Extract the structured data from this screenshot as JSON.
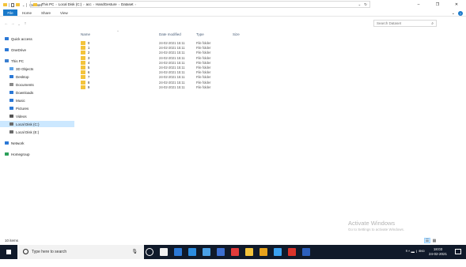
{
  "window": {
    "title": "Dataset",
    "minimize_glyph": "–",
    "maximize_glyph": "❐",
    "close_glyph": "✕"
  },
  "ribbon": {
    "tabs": [
      "File",
      "Home",
      "Share",
      "View"
    ],
    "expand_glyph": "⌄",
    "help_glyph": "?"
  },
  "nav": {
    "back": "←",
    "forward": "→",
    "recent": "⌄",
    "up": "↑"
  },
  "address": {
    "breadcrumbs": [
      "This PC",
      "Local Disk (C:)",
      "acc",
      "HandGesture",
      "Dataset"
    ],
    "dropdown_glyph": "⌄",
    "refresh_glyph": "↻"
  },
  "search": {
    "placeholder": "Search Dataset",
    "icon_glyph": "⌕"
  },
  "sidebar": {
    "items": [
      {
        "label": "Quick access",
        "icon": "star-icon",
        "color": "#2b78d6"
      },
      {
        "label": "OneDrive",
        "icon": "cloud-icon",
        "color": "#2b78d6"
      },
      {
        "label": "This PC",
        "icon": "computer-icon",
        "color": "#3a7fd0"
      },
      {
        "label": "3D Objects",
        "icon": "cube-icon",
        "color": "#5aa2e8"
      },
      {
        "label": "Desktop",
        "icon": "desktop-icon",
        "color": "#2b78d6"
      },
      {
        "label": "Documents",
        "icon": "document-icon",
        "color": "#8a8a8a"
      },
      {
        "label": "Downloads",
        "icon": "download-icon",
        "color": "#2b78d6"
      },
      {
        "label": "Music",
        "icon": "music-icon",
        "color": "#2b78d6"
      },
      {
        "label": "Pictures",
        "icon": "pictures-icon",
        "color": "#2b78d6"
      },
      {
        "label": "Videos",
        "icon": "video-icon",
        "color": "#555555"
      },
      {
        "label": "Local Disk (C:)",
        "icon": "drive-icon",
        "color": "#6b6b6b",
        "selected": true
      },
      {
        "label": "Local Disk (E:)",
        "icon": "drive-icon",
        "color": "#6b6b6b"
      },
      {
        "label": "Network",
        "icon": "network-icon",
        "color": "#2b78d6"
      },
      {
        "label": "Homegroup",
        "icon": "homegroup-icon",
        "color": "#2ca05a"
      }
    ]
  },
  "columns": {
    "name": "Name",
    "date_modified": "Date modified",
    "type": "Type",
    "size": "Size",
    "sort_glyph": "^"
  },
  "files": [
    {
      "name": "0",
      "date": "24-02-2021 15:11",
      "type": "File folder"
    },
    {
      "name": "1",
      "date": "24-02-2021 15:11",
      "type": "File folder"
    },
    {
      "name": "2",
      "date": "24-02-2021 15:11",
      "type": "File folder"
    },
    {
      "name": "3",
      "date": "24-02-2021 15:11",
      "type": "File folder"
    },
    {
      "name": "4",
      "date": "24-02-2021 15:11",
      "type": "File folder"
    },
    {
      "name": "5",
      "date": "24-02-2021 15:11",
      "type": "File folder"
    },
    {
      "name": "6",
      "date": "24-02-2021 15:11",
      "type": "File folder"
    },
    {
      "name": "7",
      "date": "24-02-2021 15:11",
      "type": "File folder"
    },
    {
      "name": "8",
      "date": "24-02-2021 15:11",
      "type": "File folder"
    },
    {
      "name": "9",
      "date": "24-02-2021 15:11",
      "type": "File folder"
    }
  ],
  "status": {
    "item_count": "10 items",
    "details_view_glyph": "☰",
    "icons_view_glyph": "▦"
  },
  "watermark": {
    "line1": "Activate Windows",
    "line2": "Go to Settings to activate Windows."
  },
  "taskbar": {
    "search_placeholder": "Type here to search",
    "mic_glyph": "🎙",
    "apps": [
      {
        "name": "task-view-icon",
        "color": "#ffffff"
      },
      {
        "name": "store-icon",
        "color": "#f0f0f0"
      },
      {
        "name": "mail-icon",
        "color": "#2b78d6"
      },
      {
        "name": "edge-icon",
        "color": "#2b8ce0"
      },
      {
        "name": "app-icon",
        "color": "#4aa0e6"
      },
      {
        "name": "photos-icon",
        "color": "#3c6fd1"
      },
      {
        "name": "red-app-icon",
        "color": "#e23b3b"
      },
      {
        "name": "file-explorer-icon",
        "color": "#f3c33b"
      },
      {
        "name": "chrome-icon",
        "color": "#e6a21c"
      },
      {
        "name": "document-app-icon",
        "color": "#3aa1f0"
      },
      {
        "name": "paint-icon",
        "color": "#d9342b"
      },
      {
        "name": "word-icon",
        "color": "#2b5fbd"
      }
    ],
    "tray_glyphs": "ᴿ ^ ▬ ⌇ ⁽ᴱᴺᴳ⁾",
    "time": "18:03",
    "date": "24-02-2021"
  }
}
